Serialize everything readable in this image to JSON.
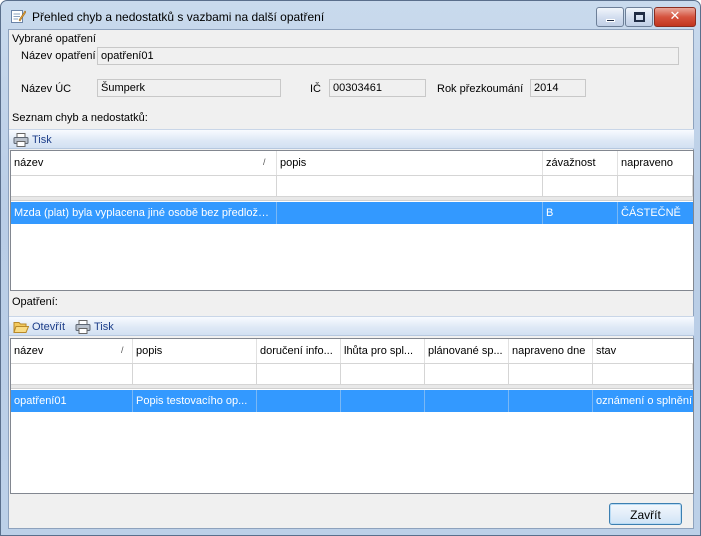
{
  "window": {
    "title": "Přehled chyb a nedostatků s vazbami na další opatření",
    "close_glyph": "✕"
  },
  "selected": {
    "group_label": "Vybrané opatření",
    "name_label": "Název opatření",
    "name_value": "opatření01",
    "uc_label": "Název ÚC",
    "uc_value": "Šumperk",
    "ic_label": "IČ",
    "ic_value": "00303461",
    "year_label": "Rok přezkoumání",
    "year_value": "2014"
  },
  "defects": {
    "section_label": "Seznam chyb a nedostatků:",
    "print_label": "Tisk",
    "columns": [
      "název",
      "popis",
      "závažnost",
      "napraveno"
    ],
    "sort_glyph": "/",
    "rows": [
      [
        "Mzda (plat) byla vyplacena jiné osobě bez předlože...",
        "",
        "B",
        "ČÁSTEČNĚ"
      ]
    ]
  },
  "measures": {
    "section_label": "Opatření:",
    "open_label": "Otevřít",
    "print_label": "Tisk",
    "columns": [
      "název",
      "popis",
      "doručení info...",
      "lhůta pro spl...",
      "plánované sp...",
      "napraveno dne",
      "stav"
    ],
    "sort_glyph": "/",
    "rows": [
      [
        "opatření01",
        "Popis testovacího op...",
        "",
        "",
        "",
        "",
        "oznámení o splnění"
      ]
    ]
  },
  "footer": {
    "close_label": "Zavřít"
  },
  "icons": {
    "title": "edit-form-icon",
    "print": "printer-icon",
    "open": "folder-open-icon"
  }
}
